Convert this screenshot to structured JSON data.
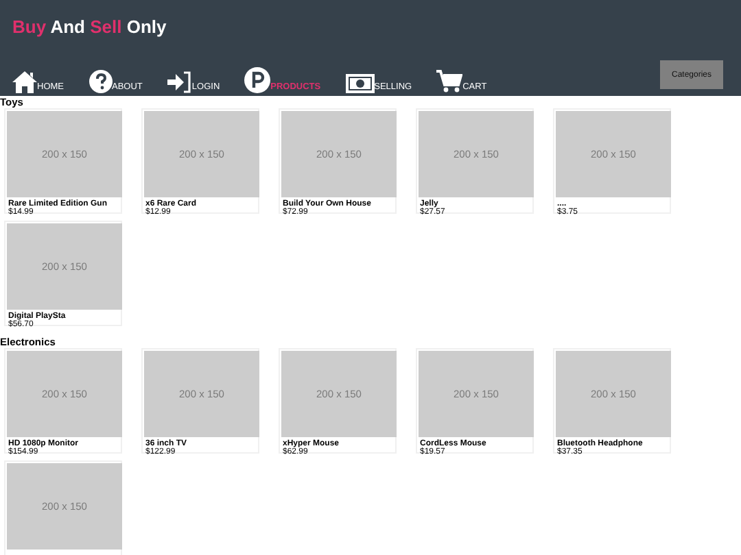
{
  "header": {
    "title_parts": [
      {
        "text": "Buy",
        "highlight": true
      },
      {
        "text": "And",
        "highlight": false
      },
      {
        "text": "Sell",
        "highlight": true
      },
      {
        "text": "Only",
        "highlight": false
      }
    ],
    "nav": [
      {
        "label": "HOME",
        "selected": false
      },
      {
        "label": "ABOUT",
        "selected": false
      },
      {
        "label": "LOGIN",
        "selected": false
      },
      {
        "label": "PRODUCTS",
        "selected": true
      },
      {
        "label": "SELLING",
        "selected": false
      },
      {
        "label": "CART",
        "selected": false
      }
    ],
    "categories_button": "Categories"
  },
  "sections": [
    {
      "title": "Toys",
      "products": [
        {
          "image_label": "200 x 150",
          "name": "Rare Limited Edition Gun",
          "price": "$14.99"
        },
        {
          "image_label": "200 x 150",
          "name": "x6 Rare Card",
          "price": "$12.99"
        },
        {
          "image_label": "200 x 150",
          "name": "Build Your Own House",
          "price": "$72.99"
        },
        {
          "image_label": "200 x 150",
          "name": "Jelly",
          "price": "$27.57"
        },
        {
          "image_label": "200 x 150",
          "name": "....",
          "price": "$3.75"
        },
        {
          "image_label": "200 x 150",
          "name": "Digital PlaySta",
          "price": "$56.70"
        }
      ]
    },
    {
      "title": "Electronics",
      "products": [
        {
          "image_label": "200 x 150",
          "name": "HD 1080p Monitor",
          "price": "$154.99"
        },
        {
          "image_label": "200 x 150",
          "name": "36 inch TV",
          "price": "$122.99"
        },
        {
          "image_label": "200 x 150",
          "name": "xHyper Mouse",
          "price": "$62.99"
        },
        {
          "image_label": "200 x 150",
          "name": "CordLess Mouse",
          "price": "$19.57"
        },
        {
          "image_label": "200 x 150",
          "name": "Bluetooth Headphone",
          "price": "$37.35"
        },
        {
          "image_label": "200 x 150"
        }
      ]
    }
  ]
}
